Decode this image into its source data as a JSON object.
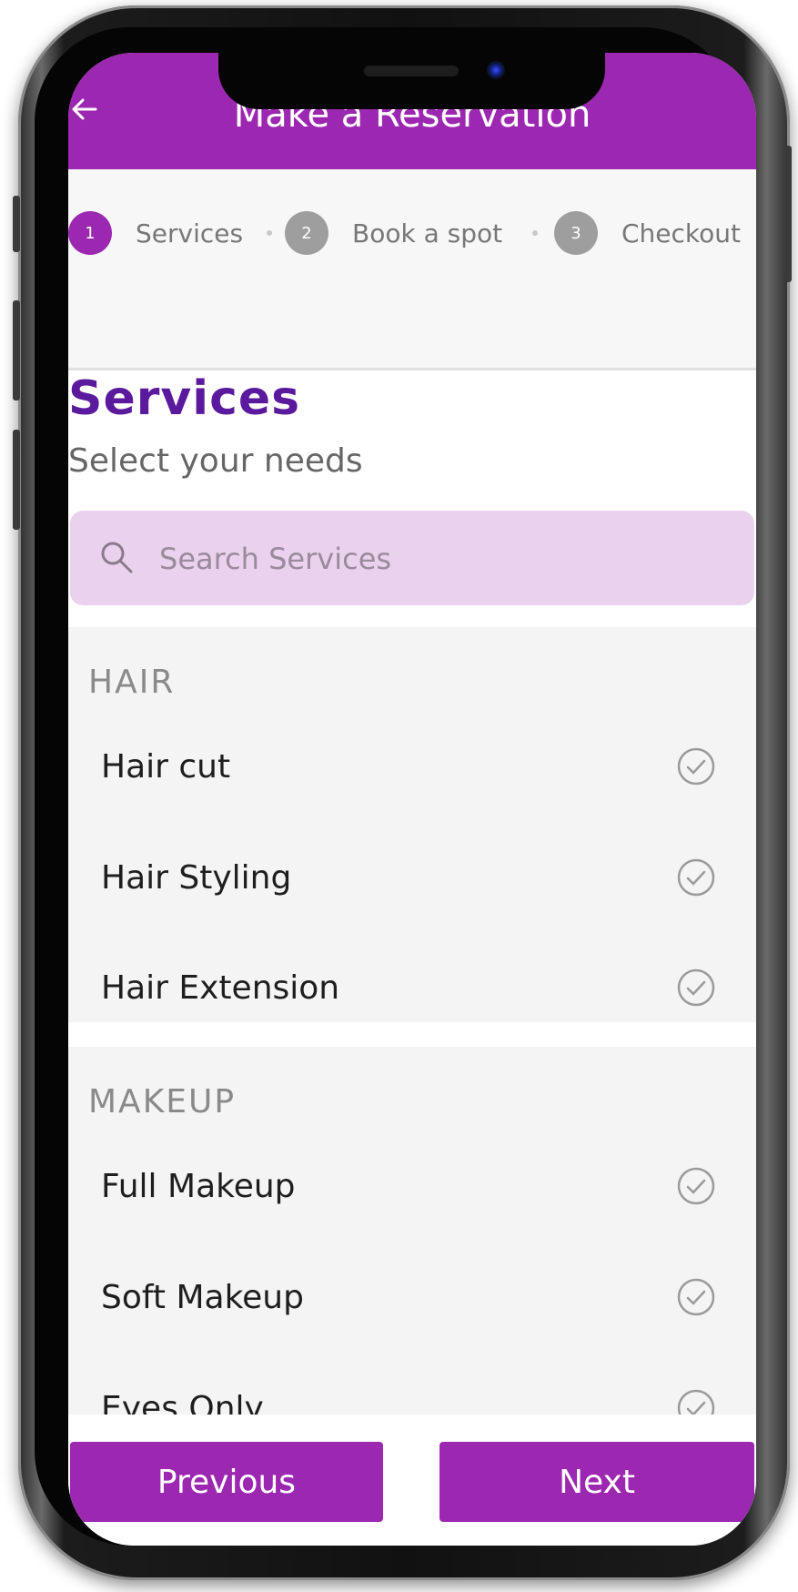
{
  "header": {
    "title": "Make a Reservation",
    "back_icon": "arrow-left-icon"
  },
  "stepper": {
    "steps": [
      {
        "number": "1",
        "label": "Services",
        "state": "active",
        "color": "#9c27b0"
      },
      {
        "number": "2",
        "label": "Book a spot",
        "state": "inactive",
        "color": "#9e9e9e"
      },
      {
        "number": "3",
        "label": "Checkout",
        "state": "inactive",
        "color": "#9e9e9e"
      }
    ]
  },
  "main": {
    "title": "Services",
    "subtitle": "Select your needs",
    "search": {
      "placeholder": "Search Services",
      "value": "",
      "icon": "search-icon"
    }
  },
  "groups": [
    {
      "title": "HAIR",
      "items": [
        {
          "name": "Hair cut",
          "selected": false
        },
        {
          "name": "Hair Styling",
          "selected": false
        },
        {
          "name": "Hair Extension",
          "selected": false
        }
      ]
    },
    {
      "title": "MAKEUP",
      "items": [
        {
          "name": "Full Makeup",
          "selected": false
        },
        {
          "name": "Soft Makeup",
          "selected": false
        },
        {
          "name": "Eyes Only",
          "selected": false
        }
      ]
    }
  ],
  "footer": {
    "previous_label": "Previous",
    "next_label": "Next"
  },
  "colors": {
    "brand": "#9c27b0",
    "title": "#5b1a9e",
    "search_bg": "#ead2ee",
    "group_bg": "#f4f4f4"
  }
}
